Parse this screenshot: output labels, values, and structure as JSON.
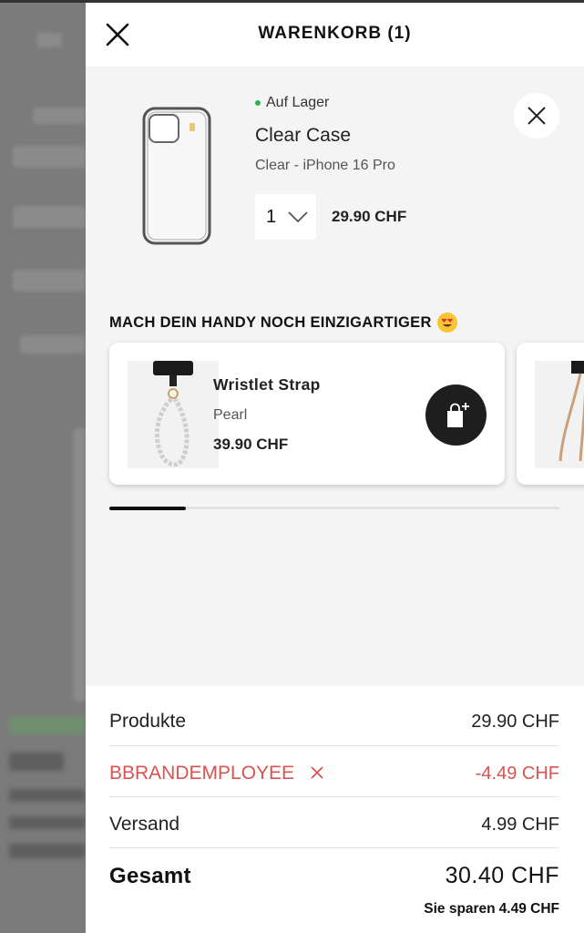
{
  "header": {
    "title": "WARENKORB (1)"
  },
  "cart_item": {
    "stock_status": "Auf Lager",
    "name": "Clear Case",
    "variant": "Clear - iPhone 16 Pro",
    "quantity": "1",
    "price": "29.90 CHF"
  },
  "upsell": {
    "title": "MACH DEIN HANDY NOCH EINZIGARTIGER",
    "emoji": "heart-eyes-emoji",
    "products": [
      {
        "name": "Wristlet Strap",
        "variant": "Pearl",
        "price": "39.90 CHF"
      }
    ],
    "scroll_progress": 0.17
  },
  "summary": {
    "products_label": "Produkte",
    "products_value": "29.90 CHF",
    "coupon_code": "BBRANDEMPLOYEE",
    "coupon_value": "-4.49 CHF",
    "shipping_label": "Versand",
    "shipping_value": "4.99 CHF",
    "total_label": "Gesamt",
    "total_value": "30.40 CHF",
    "savings_label": "Sie sparen",
    "savings_value": "4.49 CHF"
  },
  "colors": {
    "stock_green": "#2bb24c",
    "discount_red": "#d9534f",
    "add_button": "#1e1e1e"
  }
}
